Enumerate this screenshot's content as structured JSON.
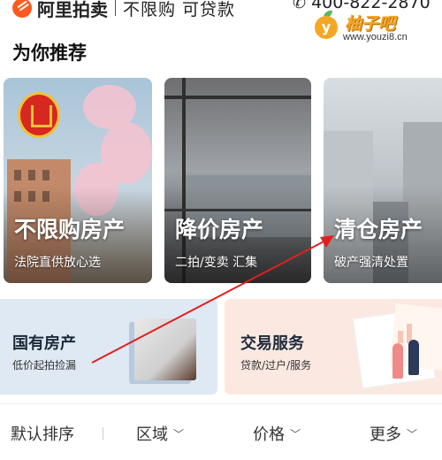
{
  "topbar": {
    "brand": "阿里拍卖",
    "slogan": "不限购 可贷款",
    "phone": "400-822-2870"
  },
  "watermark": {
    "badge": "y",
    "title": "柚子吧",
    "url": "www.youzi8.cn"
  },
  "section_title": "为你推荐",
  "cards": [
    {
      "title": "不限购房产",
      "subtitle": "法院直供放心选"
    },
    {
      "title": "降价房产",
      "subtitle": "二拍/变卖 汇集"
    },
    {
      "title": "清仓房产",
      "subtitle": "破产强清处置"
    }
  ],
  "banners": [
    {
      "title": "国有房产",
      "subtitle": "低价起拍捡漏"
    },
    {
      "title": "交易服务",
      "subtitle": "贷款/过户/服务"
    }
  ],
  "filters": [
    {
      "label": "默认排序"
    },
    {
      "label": "区域"
    },
    {
      "label": "价格"
    },
    {
      "label": "更多"
    }
  ],
  "colors": {
    "brand_orange": "#ff5a1f",
    "annotation_red": "#e02020",
    "watermark_orange": "#f5a623"
  },
  "icons": [
    "alibaba-auction-logo-icon",
    "phone-icon",
    "chevron-down-icon"
  ]
}
